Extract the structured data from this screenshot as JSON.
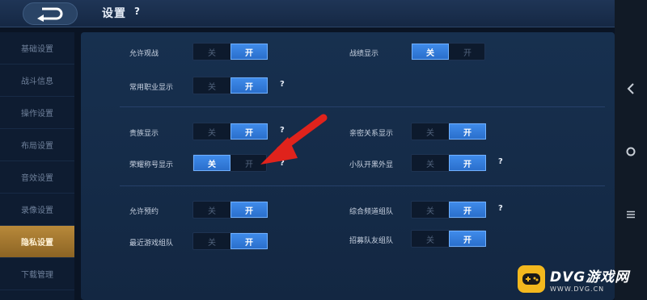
{
  "header": {
    "title": "设置",
    "help": "?"
  },
  "sidebar": {
    "items": [
      {
        "label": "基础设置",
        "active": false
      },
      {
        "label": "战斗信息",
        "active": false
      },
      {
        "label": "操作设置",
        "active": false
      },
      {
        "label": "布局设置",
        "active": false
      },
      {
        "label": "音效设置",
        "active": false
      },
      {
        "label": "录像设置",
        "active": false
      },
      {
        "label": "隐私设置",
        "active": true
      },
      {
        "label": "下载管理",
        "active": false
      }
    ]
  },
  "toggle_labels": {
    "off": "关",
    "on": "开"
  },
  "help_mark": "?",
  "settings": [
    {
      "label": "允许观战",
      "value": "开",
      "help": false
    },
    {
      "label": "战绩显示",
      "value": "关",
      "help": false
    },
    {
      "label": "常用职业显示",
      "value": "开",
      "help": true
    },
    {
      "label": "贵族显示",
      "value": "开",
      "help": true
    },
    {
      "label": "亲密关系显示",
      "value": "开",
      "help": false
    },
    {
      "label": "荣耀称号显示",
      "value": "关",
      "help": true
    },
    {
      "label": "小队开黑外显",
      "value": "开",
      "help": true
    },
    {
      "label": "允许预约",
      "value": "开",
      "help": false
    },
    {
      "label": "综合频道组队",
      "value": "开",
      "help": true
    },
    {
      "label": "最近游戏组队",
      "value": "开",
      "help": false
    },
    {
      "label": "招募队友组队",
      "value": "开",
      "help": false
    }
  ],
  "system_bar": {
    "icons": [
      "chevron-left-icon",
      "home-circle-icon",
      "menu-icon"
    ]
  },
  "watermark": {
    "name": "DVG游戏网",
    "url": "WWW.DVG.CN"
  },
  "colors": {
    "toggle_on": "#3f8bea",
    "sidebar_active": "#b8893a",
    "arrow": "#e0231c",
    "watermark_logo": "#f3b81e"
  }
}
